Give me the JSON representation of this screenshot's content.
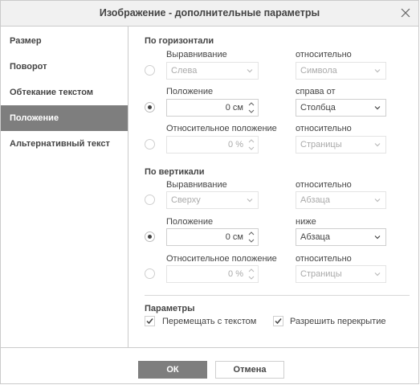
{
  "dialog": {
    "title": "Изображение - дополнительные параметры",
    "close_icon": "close-icon"
  },
  "sidebar": {
    "items": [
      {
        "label": "Размер",
        "active": false
      },
      {
        "label": "Поворот",
        "active": false
      },
      {
        "label": "Обтекание текстом",
        "active": false
      },
      {
        "label": "Положение",
        "active": true
      },
      {
        "label": "Альтернативный текст",
        "active": false
      }
    ]
  },
  "horizontal": {
    "title": "По горизонтали",
    "alignment": {
      "label": "Выравнивание",
      "value": "Слева",
      "relative_label": "относительно",
      "relative_value": "Символа",
      "selected": false
    },
    "position": {
      "label": "Положение",
      "value": "0 см",
      "relative_label": "справа от",
      "relative_value": "Столбца",
      "selected": true
    },
    "relative": {
      "label": "Относительное положение",
      "value": "0 %",
      "relative_label": "относительно",
      "relative_value": "Страницы",
      "selected": false
    }
  },
  "vertical": {
    "title": "По вертикали",
    "alignment": {
      "label": "Выравнивание",
      "value": "Сверху",
      "relative_label": "относительно",
      "relative_value": "Абзаца",
      "selected": false
    },
    "position": {
      "label": "Положение",
      "value": "0 см",
      "relative_label": "ниже",
      "relative_value": "Абзаца",
      "selected": true
    },
    "relative": {
      "label": "Относительное положение",
      "value": "0 %",
      "relative_label": "относительно",
      "relative_value": "Страницы",
      "selected": false
    }
  },
  "params": {
    "title": "Параметры",
    "move_with_text": {
      "label": "Перемещать с текстом",
      "checked": true
    },
    "allow_overlap": {
      "label": "Разрешить перекрытие",
      "checked": true
    }
  },
  "footer": {
    "ok_label": "ОК",
    "cancel_label": "Отмена"
  },
  "colors": {
    "active_bg": "#7e7e7e",
    "border": "#cbcbcb",
    "text": "#444444"
  }
}
